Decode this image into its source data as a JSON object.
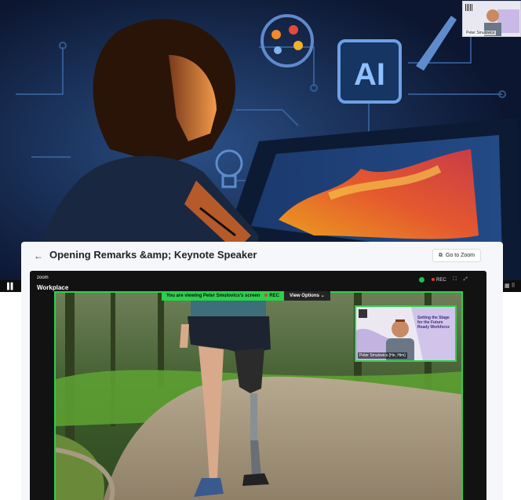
{
  "thumbnail_top": {
    "name": "Peter Smulovics"
  },
  "hero": {
    "ai_label": "AI"
  },
  "card": {
    "back_icon": "←",
    "title": "Opening Remarks &amp; Keynote Speaker",
    "go_to_zoom": "Go to Zoom"
  },
  "zoom": {
    "logo_top": "zoom",
    "logo_bottom": "Workplace",
    "rec_label": "REC",
    "viewing_text": "You are viewing Peter Smulovics's screen",
    "viewing_rec": "REC",
    "view_options": "View Options",
    "speaker_label": "Peter Smulovics (He, Him)",
    "slide_text": "Setting the Stage for the Future Ready Workforce"
  },
  "colors": {
    "accent_green": "#2bd14b",
    "hero_bg": "#101c36",
    "zoom_bg": "#121212"
  }
}
